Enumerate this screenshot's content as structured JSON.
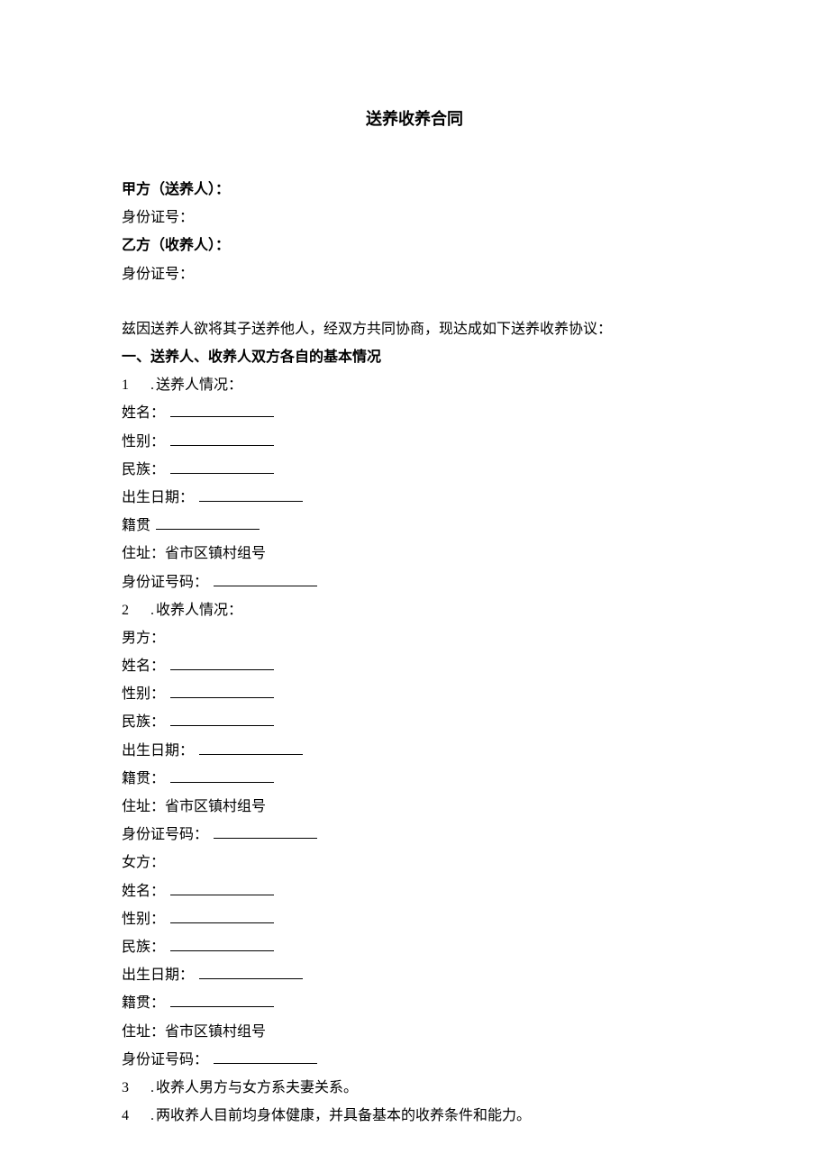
{
  "title": "送养收养合同",
  "partyA": {
    "label": "甲方（送养人）：",
    "idLabel": "身份证号："
  },
  "partyB": {
    "label": "乙方（收养人）：",
    "idLabel": "身份证号："
  },
  "intro": "兹因送养人欲将其子送养他人，经双方共同协商，现达成如下送养收养协议：",
  "section1Heading": "一、送养人、收养人双方各自的基本情况",
  "item1": {
    "num": "1",
    "dot": ".",
    "text": "送养人情况："
  },
  "sender": {
    "name": "姓名：",
    "gender": "性别：",
    "ethnicity": "民族：",
    "dob": "出生日期：",
    "hometown": "籍贯",
    "address": "住址：省市区镇村组号",
    "idNumber": "身份证号码："
  },
  "item2": {
    "num": "2",
    "dot": ".",
    "text": "收养人情况："
  },
  "adopter": {
    "maleLabel": "男方：",
    "femaleLabel": "女方：",
    "name": "姓名：",
    "gender": "性别：",
    "ethnicity": "民族：",
    "dob": "出生日期：",
    "hometown": "籍贯：",
    "address": "住址：省市区镇村组号",
    "idNumber": "身份证号码："
  },
  "item3": {
    "num": "3",
    "dot": ".",
    "text": "收养人男方与女方系夫妻关系。"
  },
  "item4": {
    "num": "4",
    "dot": ".",
    "text": "两收养人目前均身体健康，并具备基本的收养条件和能力。"
  }
}
